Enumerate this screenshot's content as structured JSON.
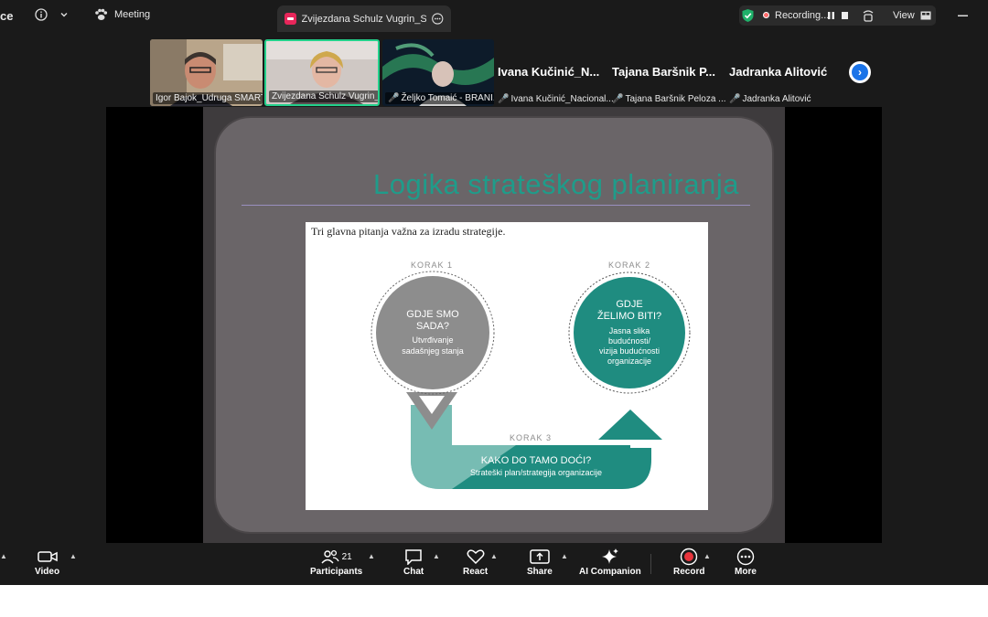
{
  "titlebar": {
    "app_fragment": "ce",
    "meeting_label": "Meeting",
    "active_tab_label": "Zvijezdana Schulz Vugrin_SMART",
    "recording_label": "Recording...",
    "view_label": "View"
  },
  "participants": [
    {
      "name": "Igor Bajok_Udruga SMART"
    },
    {
      "name": "Zvijezdana Schulz Vugrin_..."
    },
    {
      "name": "Željko Tomaić - BRANI..."
    },
    {
      "big": "Ivana  Kučinić_N...",
      "name": "Ivana Kučinić_Nacional..."
    },
    {
      "big": "Tajana  Baršnik  P...",
      "name": "Tajana Baršnik Peloza ..."
    },
    {
      "big": "Jadranka Alitović",
      "name": "Jadranka Alitović"
    }
  ],
  "slide": {
    "title": "Logika strateškog planiranja",
    "intro": "Tri glavna pitanja važna za izradu strategije.",
    "step1": {
      "label": "KORAK 1",
      "q1": "GDJE SMO",
      "q2": "SADA?",
      "d1": "Utvrđivanje",
      "d2": "sadašnjeg stanja"
    },
    "step2": {
      "label": "KORAK 2",
      "q1": "GDJE",
      "q2": "ŽELIMO BITI?",
      "d1": "Jasna slika",
      "d2": "budućnosti/",
      "d3": "vizija budućnosti",
      "d4": "organizacije"
    },
    "step3": {
      "label": "KORAK 3",
      "q": "KAKO DO TAMO DOĆI?",
      "d": "Strateški plan/strategija organizacije"
    }
  },
  "toolbar": {
    "video": "Video",
    "participants": "Participants",
    "participants_count": "21",
    "chat": "Chat",
    "react": "React",
    "share": "Share",
    "ai": "AI Companion",
    "record": "Record",
    "more": "More"
  },
  "colors": {
    "teal": "#1f8c80",
    "grey": "#8d8d8d",
    "record_red": "#e8343c",
    "zoom_blue": "#1a73e8"
  }
}
